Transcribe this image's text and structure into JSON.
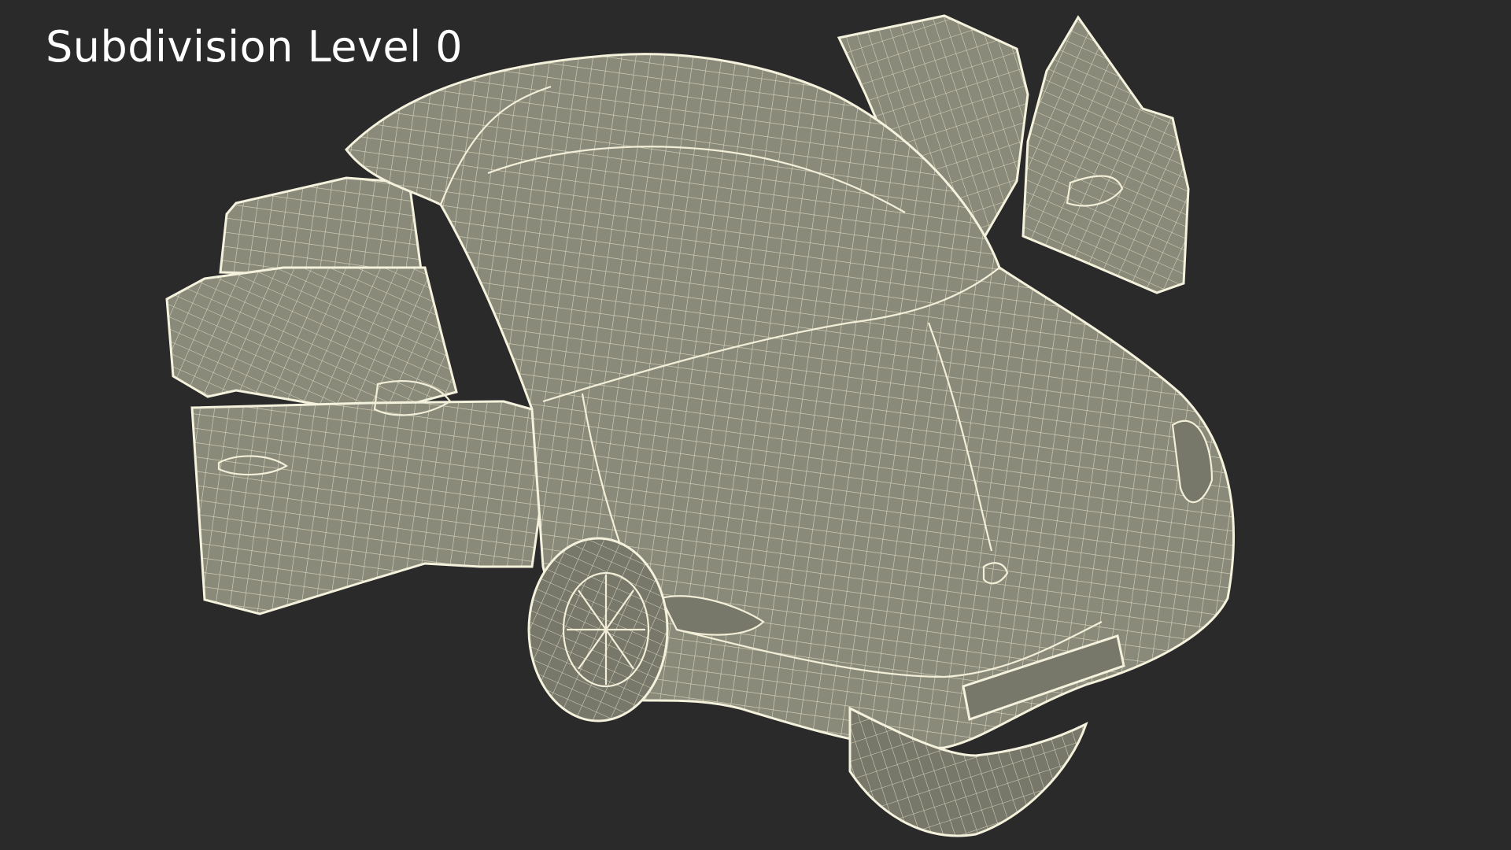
{
  "caption": {
    "text": "Subdivision Level 0"
  },
  "scene": {
    "background_color": "#2a2a2a",
    "mesh_fill_color": "#8a8a7a",
    "wire_color": "#f4f1dc",
    "subject": "wireframe-car-doors-open"
  }
}
